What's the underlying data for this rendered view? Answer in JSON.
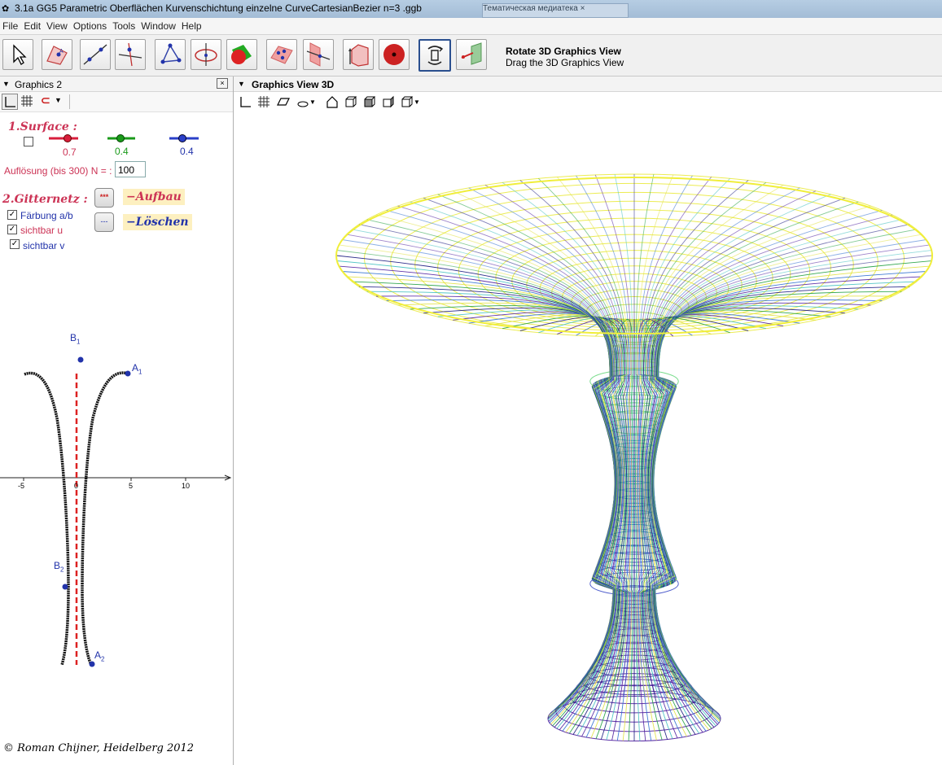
{
  "window": {
    "title": "3.1a    GG5 Parametric Oberflächen Kurvenschichtung einzelne CurveCartesianBezier n=3 .ggb",
    "browser_tab": "Тематическая медиатека"
  },
  "menu": [
    "File",
    "Edit",
    "View",
    "Options",
    "Tools",
    "Window",
    "Help"
  ],
  "toolbar": {
    "tools": [
      "move-tool",
      "polygon-point-tool",
      "line-tool",
      "perpendicular-tool",
      "triangle-tool",
      "circle-axis-tool",
      "intersect-surfaces-tool",
      "plane-points-tool",
      "plane-tool",
      "prism-tool",
      "sphere-tool",
      "rotate-view-tool",
      "view-direction-tool"
    ],
    "selected": "rotate-view-tool",
    "desc_title": "Rotate 3D Graphics View",
    "desc_sub": "Drag the 3D Graphics View"
  },
  "graphics2": {
    "title": "Graphics 2",
    "surface_label": "1.Surface :",
    "slider_red": "0.7",
    "slider_green": "0.4",
    "slider_blue": "0.4",
    "resolution_label": "Auflösung (bis 300) N = :",
    "resolution_value": "100",
    "grid_label": "2.Gitternetz :",
    "btn_build": "***",
    "btn_build_label": "−Aufbau",
    "btn_delete": "---",
    "btn_delete_label": "−Löschen",
    "cb_color": "Färbung a/b",
    "cb_u": "sichtbar u",
    "cb_v": "sichtbar v",
    "points": {
      "b1": "B",
      "b1_sub": "1",
      "a1": "A",
      "a1_sub": "1",
      "b2": "B",
      "b2_sub": "2",
      "a2": "A",
      "a2_sub": "2"
    },
    "axis_ticks": [
      "-5",
      "0",
      "5",
      "10"
    ],
    "copyright": "© Roman Chijner, Heidelberg 2012"
  },
  "view3d": {
    "title": "Graphics View 3D"
  },
  "colors": {
    "red": "#d81e3c",
    "green": "#1a9a1a",
    "blue": "#2a3fc8",
    "yellow": "#f0ee3a"
  }
}
